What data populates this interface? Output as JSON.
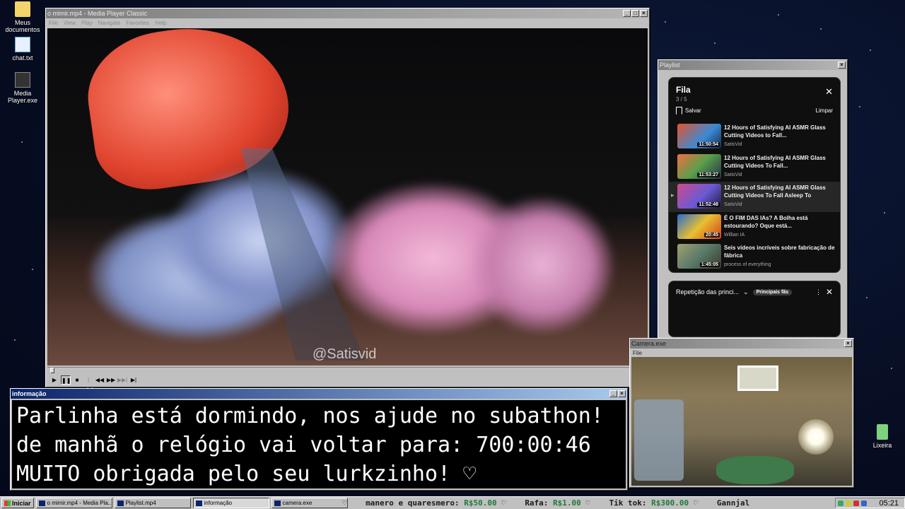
{
  "desktop": {
    "icons": [
      {
        "label": "Meus documentos",
        "icon": "folder-icon"
      },
      {
        "label": "chat.txt",
        "icon": "notepad-icon"
      },
      {
        "label": "Media Player.exe",
        "icon": "media-player-icon"
      },
      {
        "label": "Lixeira",
        "icon": "recycle-bin-icon"
      }
    ]
  },
  "media_player": {
    "title": "o mimir.mp4 - Media Player Classic",
    "menu": [
      "File",
      "View",
      "Play",
      "Navigate",
      "Favorites",
      "Help"
    ],
    "watermark": "@Satisvid",
    "position_fraction": 0.01
  },
  "playlist_window": {
    "title": "Playlist",
    "panel_title": "Fila",
    "count": "3 / 5",
    "save_label": "Salvar",
    "clear_label": "Limpar",
    "items": [
      {
        "title": "12 Hours of Satisfying AI ASMR Glass Cutting Videos to Fall...",
        "channel": "SatisVid",
        "duration": "11:50:54",
        "current": false
      },
      {
        "title": "12 Hours of Satisfying AI ASMR Glass Cutting Videos To Fall...",
        "channel": "SatisVid",
        "duration": "11:53:27",
        "current": false
      },
      {
        "title": "12 Hours of Satisfying AI ASMR Glass Cutting Videos To Fall Asleep To",
        "channel": "SatisVid",
        "duration": "11:52:48",
        "current": true
      },
      {
        "title": "É O FIM DAS IAs? A Bolha está estourando? Oque está...",
        "channel": "Willian IA",
        "duration": "20:45",
        "current": false
      },
      {
        "title": "Seis vídeos incríveis sobre fabricação de fábrica",
        "channel": "process of everything",
        "duration": "1:45:05",
        "current": false
      }
    ],
    "next_section": {
      "label": "Repetição das princi...",
      "pill": "Principais fãs"
    }
  },
  "camera_window": {
    "title": "Camera.exe",
    "menu": "File"
  },
  "info_window": {
    "title": "informação",
    "lines": [
      "Parlinha está dormindo, nos ajude no subathon!",
      "de manhã o relógio vai voltar para:  700:00:46",
      "MUITO obrigada pelo seu lurkzinho! ♡"
    ]
  },
  "taskbar": {
    "start_label": "Iniciar",
    "tasks": [
      {
        "label": "o mimir.mp4 - Media Pla...",
        "pressed": false
      },
      {
        "label": "Playlist.mp4",
        "pressed": false
      },
      {
        "label": "informação",
        "pressed": true
      },
      {
        "label": "camera.exe",
        "pressed": false
      }
    ],
    "ticker": [
      {
        "name": "",
        "amount": ""
      },
      {
        "name": "manero e quaresmero:",
        "amount": "R$50.00"
      },
      {
        "name": "Rafa:",
        "amount": "R$1.00"
      },
      {
        "name": "Tik tok:",
        "amount": "R$300.00"
      },
      {
        "name": "Gannjal",
        "amount": ""
      }
    ],
    "clock": "05:21"
  }
}
